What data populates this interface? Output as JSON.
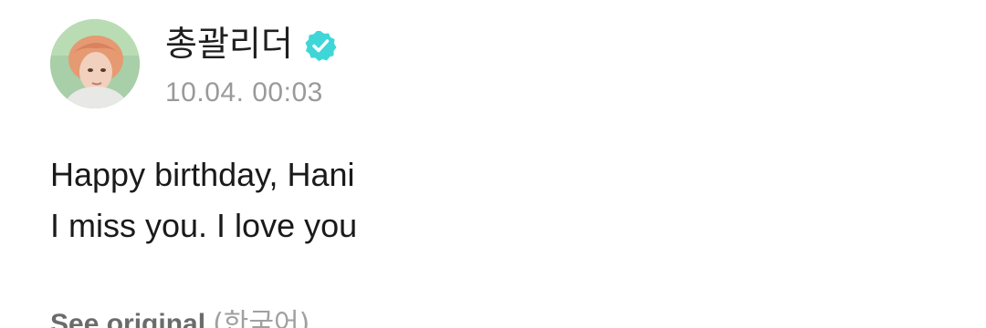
{
  "post": {
    "author_name": "총괄리더",
    "verified_icon": "verified-check-icon",
    "timestamp": "10.04. 00:03",
    "body_lines": [
      "Happy birthday, Hani",
      "I miss you. I love you"
    ],
    "see_original_label": "See original",
    "original_language": "(한국어)"
  },
  "colors": {
    "verified_badge": "#3fd6d8",
    "timestamp": "#9a9a9a",
    "text": "#1a1a1a"
  }
}
